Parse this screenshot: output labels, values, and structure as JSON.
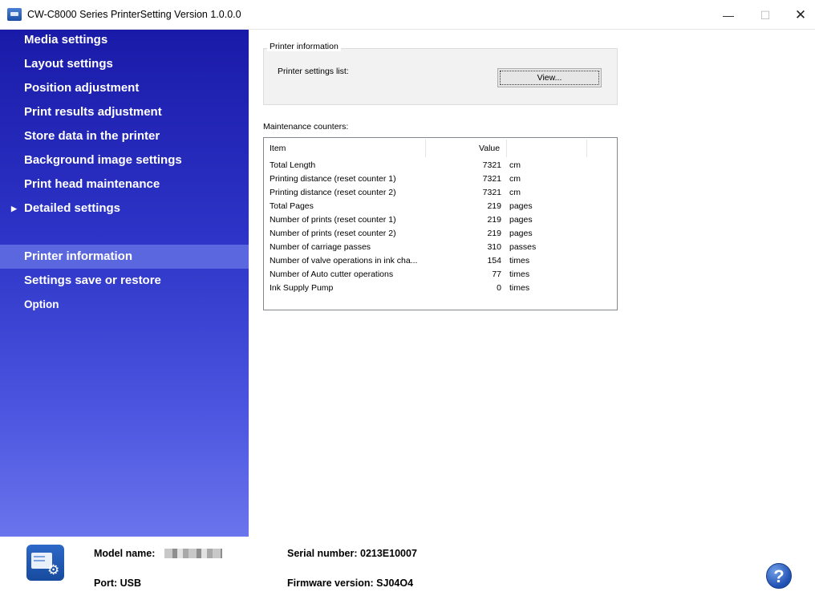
{
  "window": {
    "title": "CW-C8000 Series PrinterSetting Version 1.0.0.0",
    "min_glyph": "—",
    "max_glyph": "☐",
    "close_glyph": "✕"
  },
  "sidebar": {
    "items": [
      {
        "label": "Media settings",
        "icon": ""
      },
      {
        "label": "Layout settings",
        "icon": ""
      },
      {
        "label": "Position adjustment",
        "icon": ""
      },
      {
        "label": "Print results adjustment",
        "icon": ""
      },
      {
        "label": "Store data in the printer",
        "icon": ""
      },
      {
        "label": "Background image settings",
        "icon": ""
      },
      {
        "label": "Print head maintenance",
        "icon": ""
      },
      {
        "label": "Detailed settings",
        "icon": "▶"
      },
      {
        "label": "Printer information",
        "selected": true
      },
      {
        "label": "Settings save or restore"
      },
      {
        "label": "Option"
      }
    ]
  },
  "printer_info": {
    "group_label": "Printer information",
    "settings_list_label": "Printer settings list:",
    "view_button": "View..."
  },
  "maintenance": {
    "label": "Maintenance counters:",
    "columns": {
      "item": "Item",
      "value": "Value"
    },
    "rows": [
      {
        "item": "Total Length",
        "value": "7321",
        "unit": "cm"
      },
      {
        "item": "Printing distance (reset counter 1)",
        "value": "7321",
        "unit": "cm"
      },
      {
        "item": "Printing distance (reset counter 2)",
        "value": "7321",
        "unit": "cm"
      },
      {
        "item": "Total Pages",
        "value": "219",
        "unit": "pages"
      },
      {
        "item": "Number of prints (reset counter 1)",
        "value": "219",
        "unit": "pages"
      },
      {
        "item": "Number of prints (reset counter 2)",
        "value": "219",
        "unit": "pages"
      },
      {
        "item": "Number of carriage passes",
        "value": "310",
        "unit": "passes"
      },
      {
        "item": "Number of valve operations in ink cha...",
        "value": "154",
        "unit": "times"
      },
      {
        "item": "Number of Auto cutter operations",
        "value": "77",
        "unit": "times"
      },
      {
        "item": "Ink Supply Pump",
        "value": "0",
        "unit": "times"
      }
    ]
  },
  "footer": {
    "model_label": "Model name:",
    "port_label": "Port: USB",
    "serial_label": "Serial number: 0213E10007",
    "firmware_label": "Firmware version: SJ04O4",
    "help_glyph": "?"
  },
  "colors": {
    "sidebar_top": "#1a1aa8",
    "sidebar_bottom": "#6a74ec",
    "selected_item": "#5b67de",
    "help_blue": "#1f4fb0"
  }
}
